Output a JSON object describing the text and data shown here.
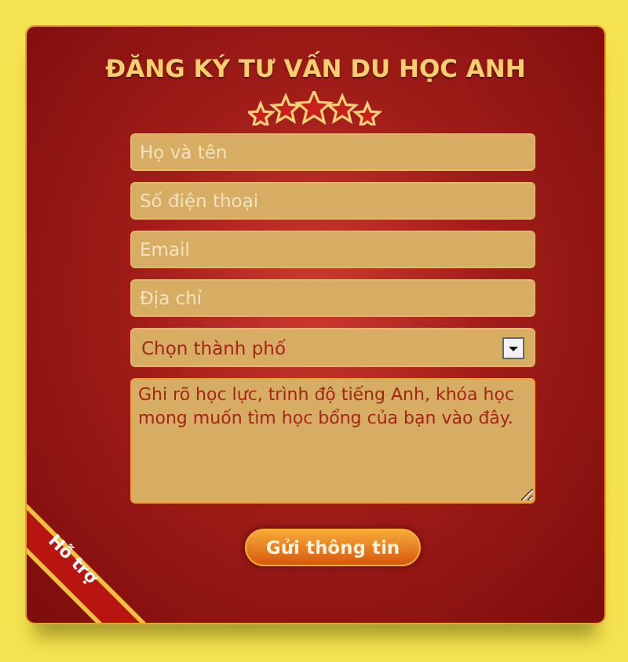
{
  "title": "ĐĂNG KÝ TƯ VẤN DU HỌC ANH",
  "fields": [
    {
      "placeholder": "Họ và tên"
    },
    {
      "placeholder": "Số điện thoại"
    },
    {
      "placeholder": "Email"
    },
    {
      "placeholder": "Địa chỉ"
    }
  ],
  "city_select": {
    "value": "Chọn thành phố"
  },
  "message": {
    "placeholder": "Ghi rõ học lực, trình độ tiếng Anh, khóa học mong muốn tìm học bổng của bạn vào đây."
  },
  "submit_button": "Gửi thông tin",
  "ribbon": "Hỗ trợ"
}
